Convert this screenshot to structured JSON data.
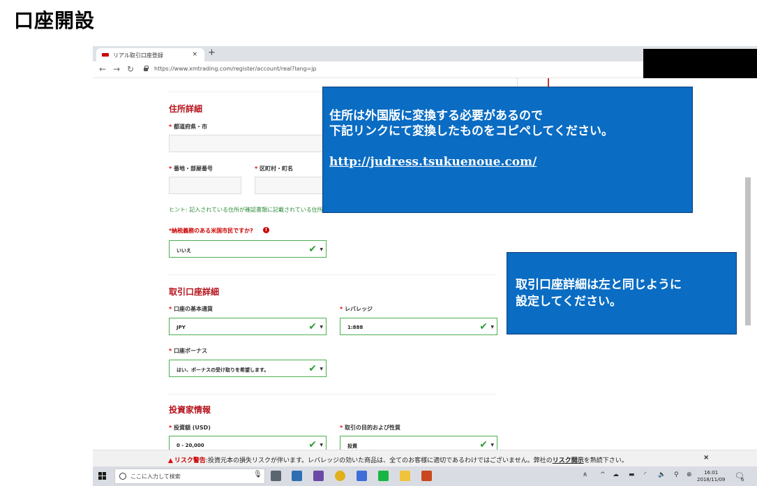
{
  "page_title": "口座開設",
  "browser": {
    "tab_title": "リアル取引口座登録",
    "tab_close": "×",
    "new_tab": "+",
    "url": "https://www.xmtrading.com/register/account/real?lang=jp"
  },
  "form": {
    "address_section": {
      "title": "住所詳細",
      "prefecture_city_label": "都道府県・市",
      "street_room_label": "番地・部屋番号",
      "ward_town_label": "区町村・町名",
      "hint": "ヒント: 記入されている住所が確認書類に記載されている住所"
    },
    "us_tax_label": "*納税義務のある米国市民ですか?",
    "us_tax_value": "いいえ",
    "account_section": {
      "title": "取引口座詳細",
      "currency_label": "口座の基本通貨",
      "currency_value": "JPY",
      "leverage_label": "レバレッジ",
      "leverage_value": "1:888",
      "bonus_label": "口座ボーナス",
      "bonus_value": "はい、ボーナスの受け取りを希望します。"
    },
    "investor_section": {
      "title": "投資家情報",
      "amount_label": "投資額 (USD)",
      "amount_value": "0 - 20,000",
      "purpose_label": "取引の目的および性質",
      "purpose_value": "投資"
    }
  },
  "risk_bar": {
    "label": "リスク警告",
    "text_a": ":投資元本の損失リスクが伴います。レバレッジの効いた商品は、全てのお客様に適切であるわけではございません。弊社の",
    "link": "リスク開示",
    "text_b": "を熟読下さい。",
    "close": "×"
  },
  "taskbar": {
    "search_placeholder": "ここに入力して検索",
    "time": "16:01",
    "date": "2018/11/09",
    "notification_count": "6"
  },
  "callouts": {
    "address_note_line1": "住所は外国版に変換する必要があるので",
    "address_note_line2": "下記リンクにて変換したものをコピペしてください。",
    "address_link": "http://judress.tsukuenoue.com/",
    "account_note_line1": "取引口座詳細は左と同じように",
    "account_note_line2": "設定してください。"
  },
  "colors": {
    "accent_red": "#b5121b",
    "valid_green": "#4caf50",
    "callout_blue": "#0a6cc3"
  }
}
